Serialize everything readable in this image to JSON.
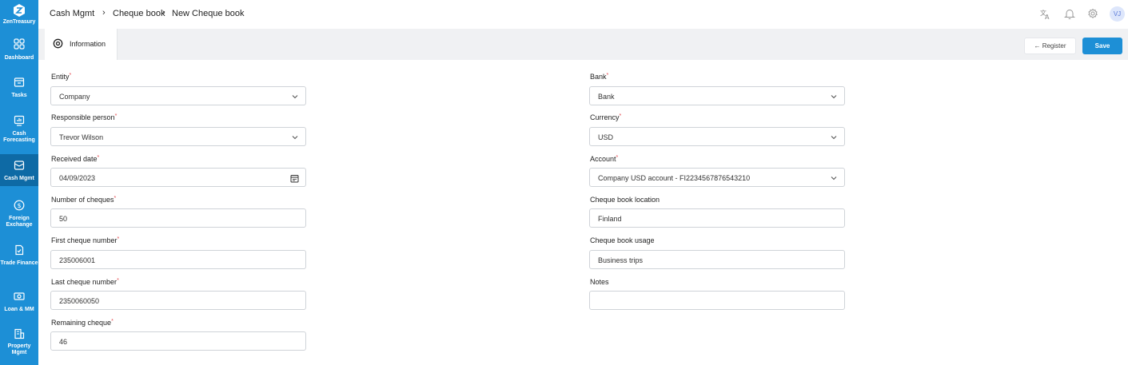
{
  "brand": {
    "name": "ZenTreasury"
  },
  "sidebar": {
    "items": [
      {
        "label": "Dashboard",
        "icon": "grid-icon",
        "active": false
      },
      {
        "label": "Tasks",
        "icon": "inbox-icon",
        "active": false
      },
      {
        "label": "Cash Forecasting",
        "icon": "chart-icon",
        "active": false
      },
      {
        "label": "Cash Mgmt",
        "icon": "cash-icon",
        "active": true
      },
      {
        "label": "Foreign Exchange",
        "icon": "dollar-icon",
        "active": false
      },
      {
        "label": "Trade Finance",
        "icon": "document-icon",
        "active": false
      },
      {
        "label": "Loan & MM",
        "icon": "banknote-icon",
        "active": false
      },
      {
        "label": "Property Mgmt",
        "icon": "building-icon",
        "active": false
      }
    ]
  },
  "header": {
    "app_title": "Cash Mgmt",
    "breadcrumb": [
      "Cheque book",
      "New Cheque book"
    ],
    "avatar_initials": "VJ",
    "icons": [
      "translate-icon",
      "bell-icon",
      "gear-icon"
    ]
  },
  "tabs": [
    {
      "label": "Information",
      "icon": "info-gear-icon"
    }
  ],
  "actions": {
    "register_label": "← Register",
    "save_label": "Save"
  },
  "form": {
    "left": [
      {
        "label": "Entity",
        "required": true,
        "value": "Company",
        "type": "select"
      },
      {
        "label": "Responsible person",
        "required": true,
        "value": "Trevor Wilson",
        "type": "select"
      },
      {
        "label": "Received date",
        "required": true,
        "value": "04/09/2023",
        "type": "date"
      },
      {
        "label": "Number of cheques",
        "required": true,
        "value": "50",
        "type": "text"
      },
      {
        "label": "First cheque number",
        "required": true,
        "value": "235006001",
        "type": "text"
      },
      {
        "label": "Last cheque number",
        "required": true,
        "value": "2350060050",
        "type": "text"
      },
      {
        "label": "Remaining cheque",
        "required": true,
        "value": "46",
        "type": "text"
      }
    ],
    "right": [
      {
        "label": "Bank",
        "required": true,
        "value": "Bank",
        "type": "select"
      },
      {
        "label": "Currency",
        "required": true,
        "value": "USD",
        "type": "select"
      },
      {
        "label": "Account",
        "required": true,
        "value": "Company USD account - FI2234567876543210",
        "type": "select"
      },
      {
        "label": "Cheque book location",
        "required": false,
        "value": "Finland",
        "type": "text"
      },
      {
        "label": "Cheque book usage",
        "required": false,
        "value": "Business trips",
        "type": "text"
      },
      {
        "label": "Notes",
        "required": false,
        "value": "",
        "type": "text"
      }
    ]
  },
  "colors": {
    "accent": "#1d8fd6",
    "sidebar_active": "#0e6aa5",
    "required": "#e5484d"
  }
}
